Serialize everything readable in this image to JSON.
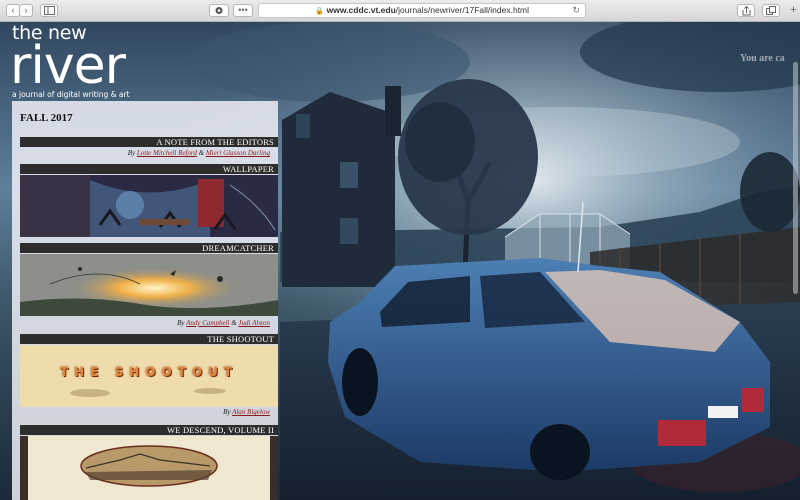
{
  "browser": {
    "url_domain": "www.cddc.vt.edu",
    "url_path": "/journals/newriver/17Fall/index.html",
    "back_icon": "chevron-left",
    "forward_icon": "chevron-right",
    "sidebar_icon": "sidebar",
    "privacy_icon": "eye",
    "extensions_icon": "dots",
    "share_icon": "share",
    "tabs_icon": "tabs",
    "new_tab_icon": "plus"
  },
  "masthead": {
    "the": "the new",
    "river": "river",
    "tagline": "a journal of digital writing & art"
  },
  "overlay_text": "You are ca",
  "issue": {
    "title": "FALL 2017",
    "entries": [
      {
        "heading": "A NOTE FROM THE EDITORS",
        "by": "By",
        "author1": "Lotte Mitchell Reford",
        "amp": "&",
        "author2": "Mieri Glasson Darling"
      },
      {
        "heading": "WALLPAPER"
      },
      {
        "heading": "DREAMCATCHER",
        "by": "By",
        "author1": "Andy Campbell",
        "amp": "&",
        "author2": "Judi Alston"
      },
      {
        "heading": "THE SHOOTOUT",
        "thumb_text": "THE SHOOTOUT",
        "by": "By",
        "author1": "Alan Bigelow"
      },
      {
        "heading": "WE DESCEND, VOLUME II"
      }
    ]
  }
}
